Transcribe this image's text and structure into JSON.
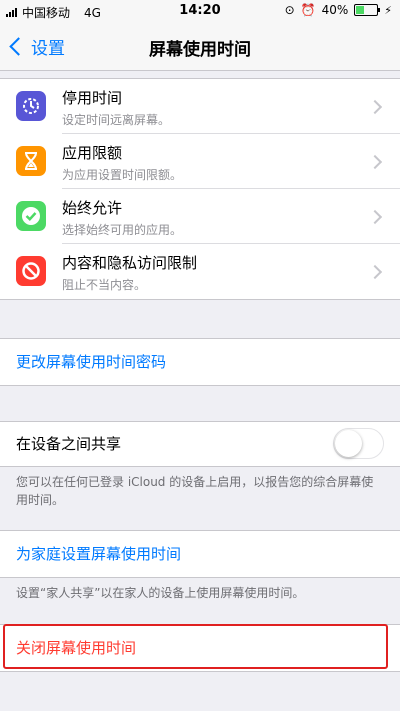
{
  "status": {
    "carrier": "中国移动",
    "network": "4G",
    "time": "14:20",
    "battery": "40%"
  },
  "nav": {
    "back_label": "设置",
    "title": "屏幕使用时间"
  },
  "features": [
    {
      "title": "停用时间",
      "subtitle": "设定时间远离屏幕。",
      "icon": "downtime-icon",
      "color": "#5856d6"
    },
    {
      "title": "应用限额",
      "subtitle": "为应用设置时间限额。",
      "icon": "hourglass-icon",
      "color": "#ff9500"
    },
    {
      "title": "始终允许",
      "subtitle": "选择始终可用的应用。",
      "icon": "check-badge-icon",
      "color": "#4cd964"
    },
    {
      "title": "内容和隐私访问限制",
      "subtitle": "阻止不当内容。",
      "icon": "no-entry-icon",
      "color": "#ff3b30"
    }
  ],
  "change_passcode": "更改屏幕使用时间密码",
  "share": {
    "label": "在设备之间共享",
    "toggle_on": false,
    "footer": "您可以在任何已登录 iCloud 的设备上启用，以报告您的综合屏幕使用时间。"
  },
  "family": {
    "label": "为家庭设置屏幕使用时间",
    "footer": "设置“家人共享”以在家人的设备上使用屏幕使用时间。"
  },
  "turn_off": "关闭屏幕使用时间"
}
